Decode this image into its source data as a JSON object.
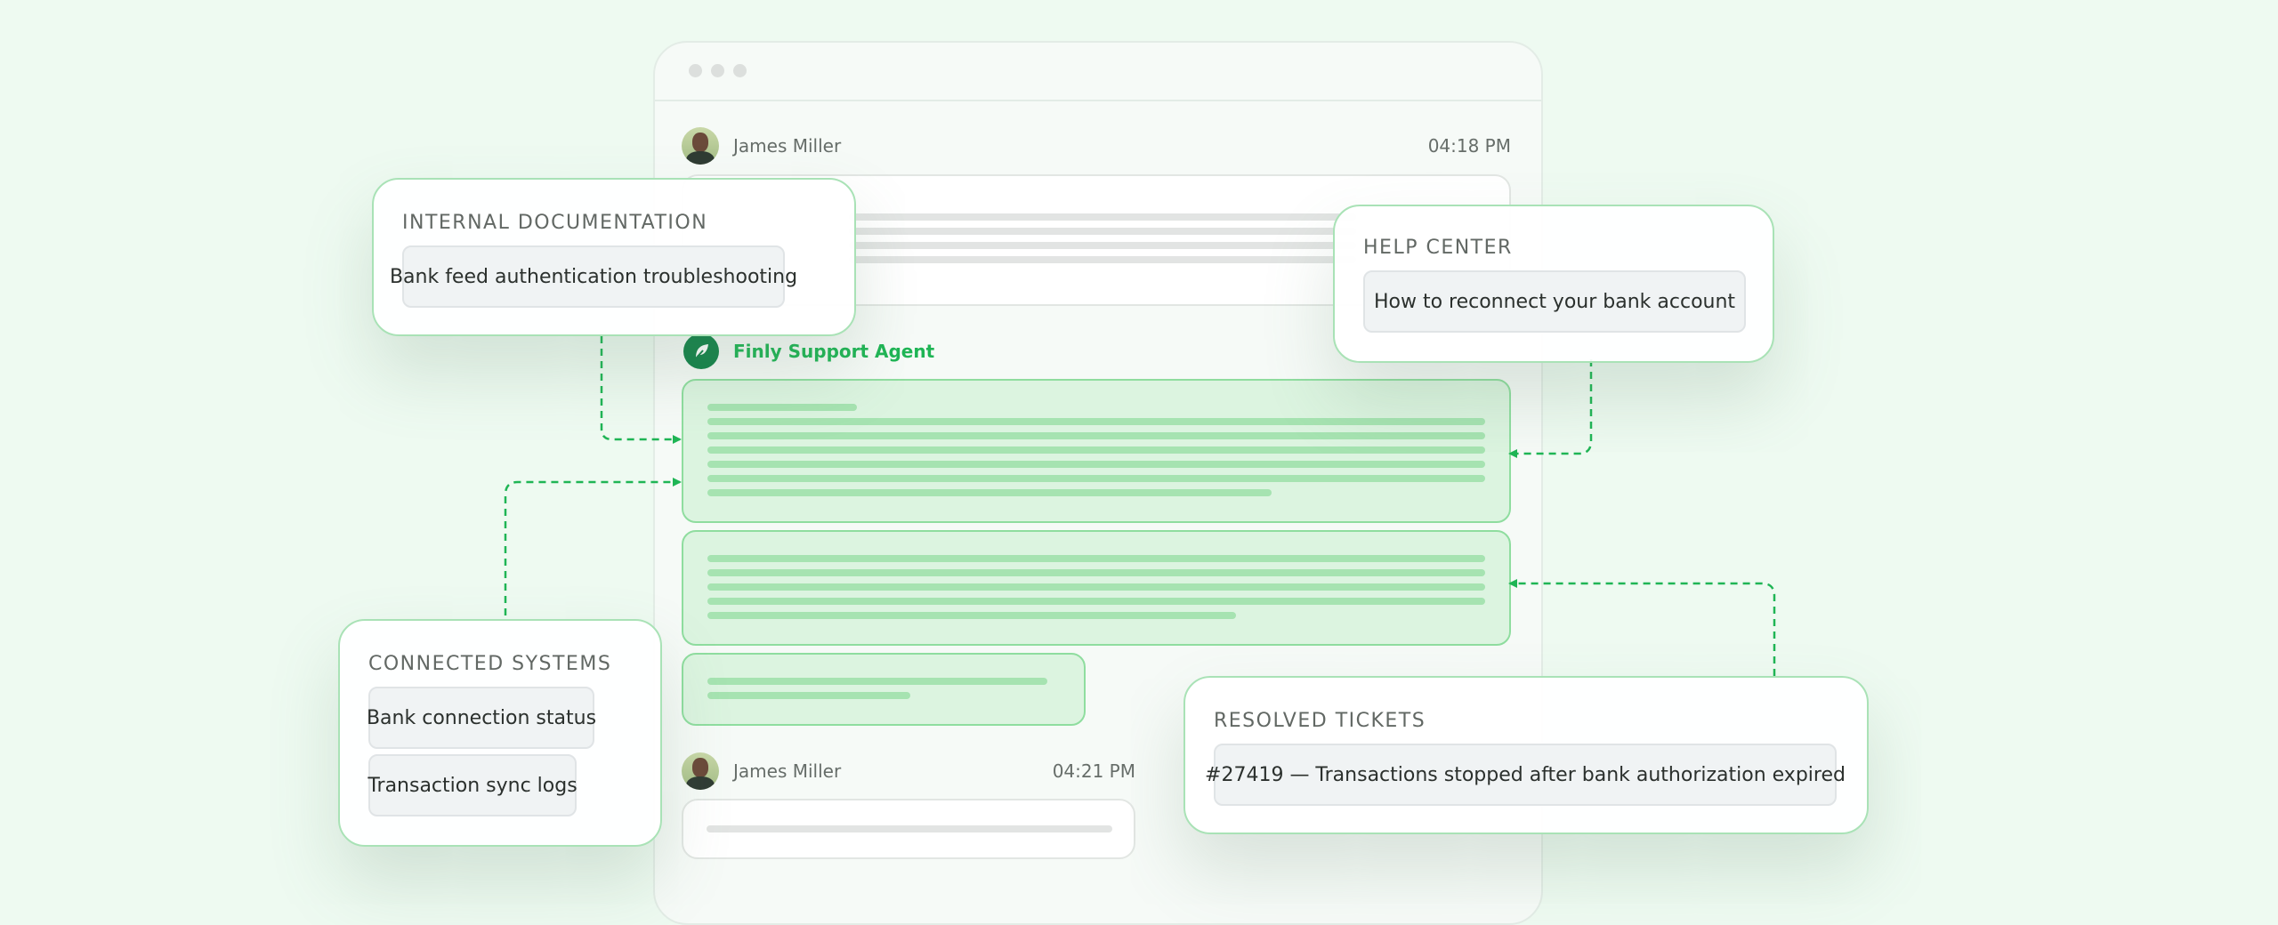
{
  "chat": {
    "messages": [
      {
        "sender": "James Miller",
        "time": "04:18 PM"
      },
      {
        "sender": "Finly Support Agent"
      },
      {
        "sender": "James Miller",
        "time": "04:21 PM"
      }
    ]
  },
  "sources": {
    "internal_documentation": {
      "title": "INTERNAL DOCUMENTATION",
      "items": [
        "Bank feed authentication troubleshooting"
      ]
    },
    "help_center": {
      "title": "HELP CENTER",
      "items": [
        "How to reconnect your bank account"
      ]
    },
    "connected_systems": {
      "title": "CONNECTED SYSTEMS",
      "items": [
        "Bank connection status",
        "Transaction sync logs"
      ]
    },
    "resolved_tickets": {
      "title": "RESOLVED TICKETS",
      "items": [
        "#27419 — Transactions stopped after bank authorization expired"
      ]
    }
  },
  "colors": {
    "accent": "#1fb555",
    "agent_logo": "#14834a",
    "background": "#eefaf1"
  },
  "icons": [
    "user-avatar",
    "leaf-logo-icon",
    "window-dots"
  ]
}
